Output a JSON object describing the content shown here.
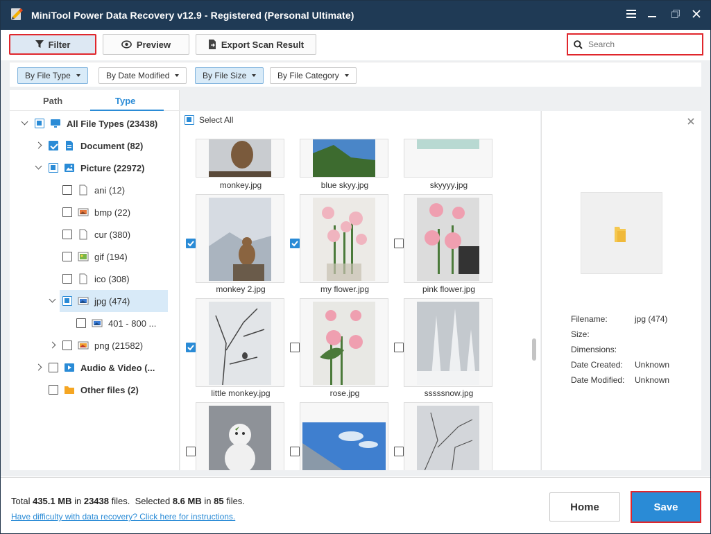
{
  "window": {
    "title": "MiniTool Power Data Recovery v12.9 - Registered (Personal Ultimate)"
  },
  "toolbar": {
    "filter_label": "Filter",
    "preview_label": "Preview",
    "export_label": "Export Scan Result",
    "search_placeholder": "Search"
  },
  "filters": [
    {
      "label": "By File Type",
      "active": true
    },
    {
      "label": "By Date Modified",
      "active": false
    },
    {
      "label": "By File Size",
      "active": true
    },
    {
      "label": "By File Category",
      "active": false
    }
  ],
  "tabs": {
    "path": "Path",
    "type": "Type",
    "active": "Type"
  },
  "tree": {
    "root": {
      "label": "All File Types (23438)",
      "state": "partial"
    },
    "document": {
      "label": "Document (82)",
      "state": "checked"
    },
    "picture": {
      "label": "Picture (22972)",
      "state": "partial"
    },
    "ani": {
      "label": "ani (12)",
      "state": "unchecked"
    },
    "bmp": {
      "label": "bmp (22)",
      "state": "unchecked"
    },
    "cur": {
      "label": "cur (380)",
      "state": "unchecked"
    },
    "gif": {
      "label": "gif (194)",
      "state": "unchecked"
    },
    "ico": {
      "label": "ico (308)",
      "state": "unchecked"
    },
    "jpg": {
      "label": "jpg (474)",
      "state": "partial"
    },
    "jpg_sub": {
      "label": "401 - 800 ...",
      "state": "unchecked"
    },
    "png": {
      "label": "png (21582)",
      "state": "unchecked"
    },
    "audio": {
      "label": "Audio & Video (...",
      "state": "unchecked"
    },
    "other": {
      "label": "Other files (2)",
      "state": "unchecked"
    }
  },
  "grid": {
    "select_all": "Select All",
    "items": [
      {
        "name": "monkey.jpg",
        "checked": false
      },
      {
        "name": "blue skyy.jpg",
        "checked": false
      },
      {
        "name": "skyyyy.jpg",
        "checked": false
      },
      {
        "name": "monkey 2.jpg",
        "checked": true
      },
      {
        "name": "my flower.jpg",
        "checked": true
      },
      {
        "name": "pink flower.jpg",
        "checked": false
      },
      {
        "name": "little monkey.jpg",
        "checked": true
      },
      {
        "name": "rose.jpg",
        "checked": false
      },
      {
        "name": "sssssnow.jpg",
        "checked": false
      },
      {
        "name": "",
        "checked": false
      },
      {
        "name": "",
        "checked": false
      },
      {
        "name": "",
        "checked": false
      }
    ]
  },
  "details": {
    "filename_label": "Filename:",
    "filename_value": "jpg (474)",
    "size_label": "Size:",
    "dimensions_label": "Dimensions:",
    "created_label": "Date Created:",
    "created_value": "Unknown",
    "modified_label": "Date Modified:",
    "modified_value": "Unknown"
  },
  "footer": {
    "total_prefix": "Total",
    "total_size": "435.1 MB",
    "in1": "in",
    "total_files": "23438",
    "files1": "files.",
    "selected_prefix": "Selected",
    "selected_size": "8.6 MB",
    "in2": "in",
    "selected_files": "85",
    "files2": "files.",
    "help_link": "Have difficulty with data recovery? Click here for instructions.",
    "home_label": "Home",
    "save_label": "Save"
  },
  "colors": {
    "titlebar": "#1f3a55",
    "accent": "#2a8bd6",
    "highlight": "#e0262c"
  }
}
